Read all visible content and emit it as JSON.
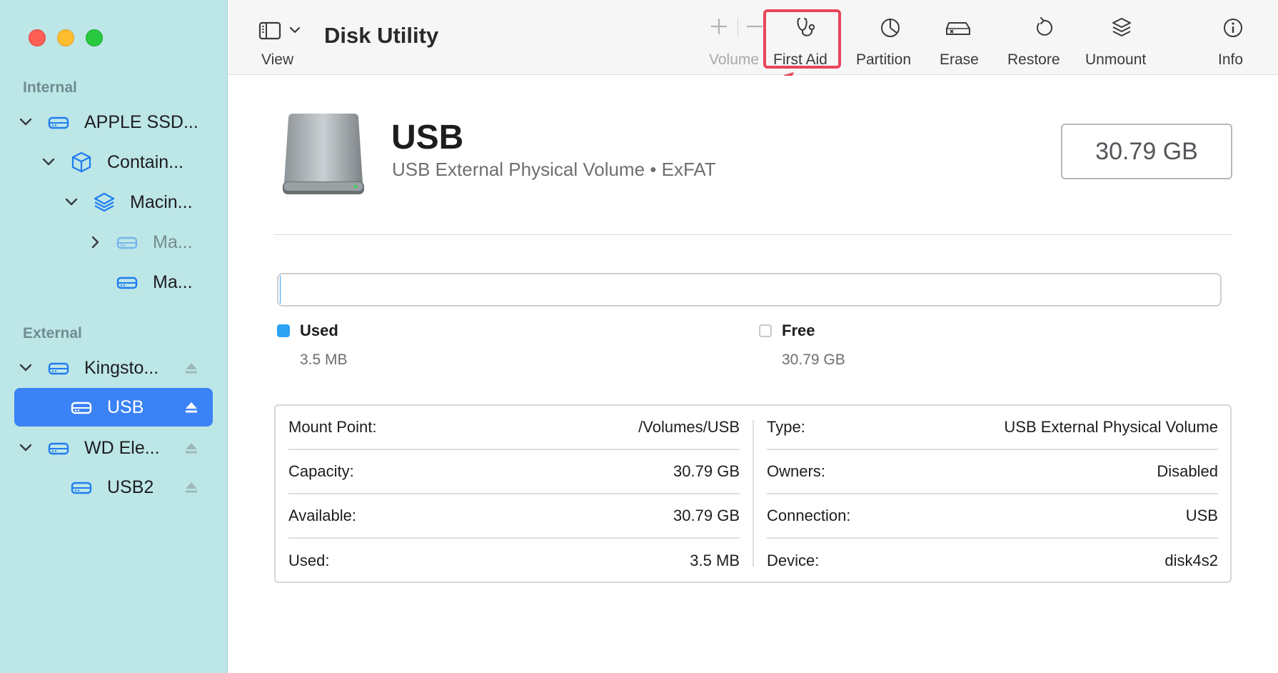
{
  "app": {
    "title": "Disk Utility"
  },
  "colors": {
    "sidebar_bg": "#bde6e7",
    "accent": "#3b82f6",
    "used_color": "#2ea2f3",
    "highlight": "#e8455a"
  },
  "toolbar": {
    "view_label": "View",
    "volume_label": "Volume",
    "first_aid_label": "First Aid",
    "partition_label": "Partition",
    "erase_label": "Erase",
    "restore_label": "Restore",
    "unmount_label": "Unmount",
    "info_label": "Info"
  },
  "sidebar": {
    "internal_title": "Internal",
    "external_title": "External",
    "items": [
      {
        "label": "APPLE SSD...",
        "icon": "drive-icon"
      },
      {
        "label": "Contain...",
        "icon": "container-icon"
      },
      {
        "label": "Macin...",
        "icon": "layers-icon"
      },
      {
        "label": "Ma...",
        "icon": "drive-icon"
      },
      {
        "label": "Ma...",
        "icon": "drive-icon"
      },
      {
        "label": "Kingsto...",
        "icon": "drive-icon"
      },
      {
        "label": "USB",
        "icon": "drive-icon",
        "selected": true
      },
      {
        "label": "WD Ele...",
        "icon": "drive-icon"
      },
      {
        "label": "USB2",
        "icon": "drive-icon"
      }
    ]
  },
  "volume": {
    "name": "USB",
    "subtitle": "USB External Physical Volume • ExFAT",
    "size": "30.79 GB",
    "used_fraction": 0.0001
  },
  "usage": {
    "used_label": "Used",
    "used_value": "3.5 MB",
    "free_label": "Free",
    "free_value": "30.79 GB"
  },
  "details": {
    "left": [
      {
        "key": "Mount Point:",
        "value": "/Volumes/USB"
      },
      {
        "key": "Capacity:",
        "value": "30.79 GB"
      },
      {
        "key": "Available:",
        "value": "30.79 GB"
      },
      {
        "key": "Used:",
        "value": "3.5 MB"
      }
    ],
    "right": [
      {
        "key": "Type:",
        "value": "USB External Physical Volume"
      },
      {
        "key": "Owners:",
        "value": "Disabled"
      },
      {
        "key": "Connection:",
        "value": "USB"
      },
      {
        "key": "Device:",
        "value": "disk4s2"
      }
    ]
  }
}
